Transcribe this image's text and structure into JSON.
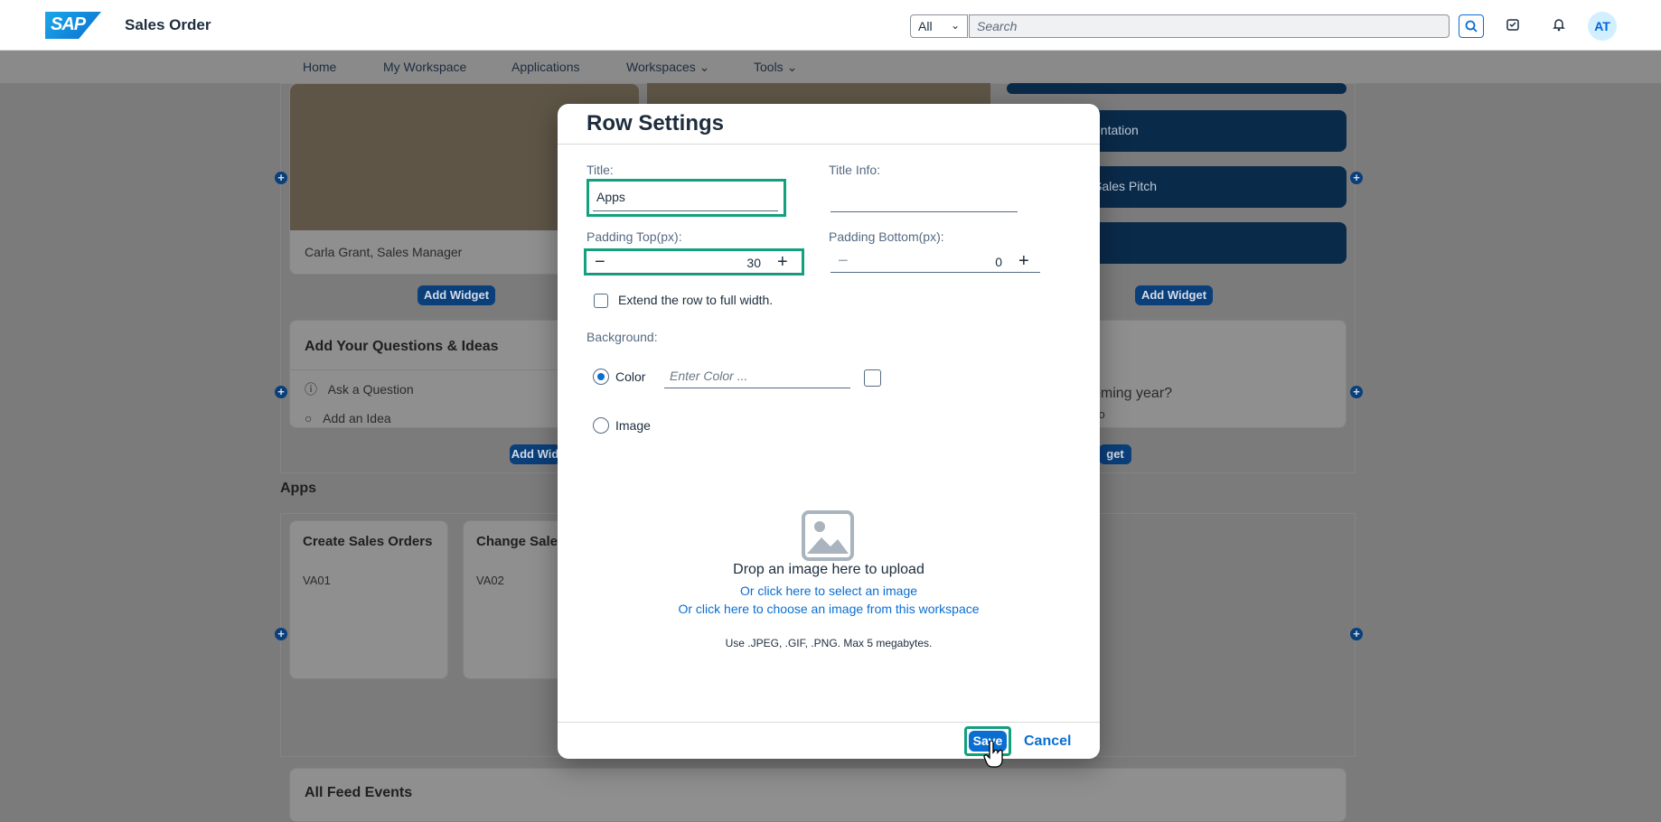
{
  "shell": {
    "logo": "SAP",
    "title": "Sales Order",
    "scope_value": "All",
    "search_placeholder": "Search",
    "avatar_initials": "AT"
  },
  "nav": {
    "items": [
      "Home",
      "My Workspace",
      "Applications",
      "Workspaces",
      "Tools"
    ]
  },
  "background": {
    "person_caption": "Carla Grant, Sales Manager",
    "add_widget": "Add Widget",
    "tile_presentation": "entation",
    "tile_sales_pitch": "Sales Pitch",
    "questions_title": "Add Your Questions & Ideas",
    "ask_question": "Ask a Question",
    "add_idea": "Add an Idea",
    "question_snippet": "coming year?",
    "question_time": "ago",
    "apps_title": "Apps",
    "app1_name": "Create Sales Orders",
    "app1_code": "VA01",
    "app2_name": "Change Sale Orders",
    "app2_code": "VA02",
    "feed_title": "All Feed Events",
    "add_widget_partial1": "Add Wid",
    "add_widget_partial2": "get"
  },
  "dialog": {
    "title": "Row Settings",
    "title_label": "Title:",
    "title_value": "Apps",
    "title_info_label": "Title Info:",
    "title_info_value": "",
    "padding_top_label": "Padding Top(px):",
    "padding_top_value": "30",
    "padding_bottom_label": "Padding Bottom(px):",
    "padding_bottom_value": "0",
    "extend_label": "Extend the row to full width.",
    "background_label": "Background:",
    "color_option": "Color",
    "color_placeholder": "Enter Color ...",
    "image_option": "Image",
    "drop_text": "Drop an image here to upload",
    "select_link": "Or click here to select an image",
    "workspace_link": "Or click here to choose an image from this workspace",
    "hint": "Use .JPEG, .GIF, .PNG. Max 5 megabytes.",
    "save": "Save",
    "cancel": "Cancel"
  },
  "colors": {
    "accent": "#0a6ed1",
    "highlight": "#12a07e"
  }
}
